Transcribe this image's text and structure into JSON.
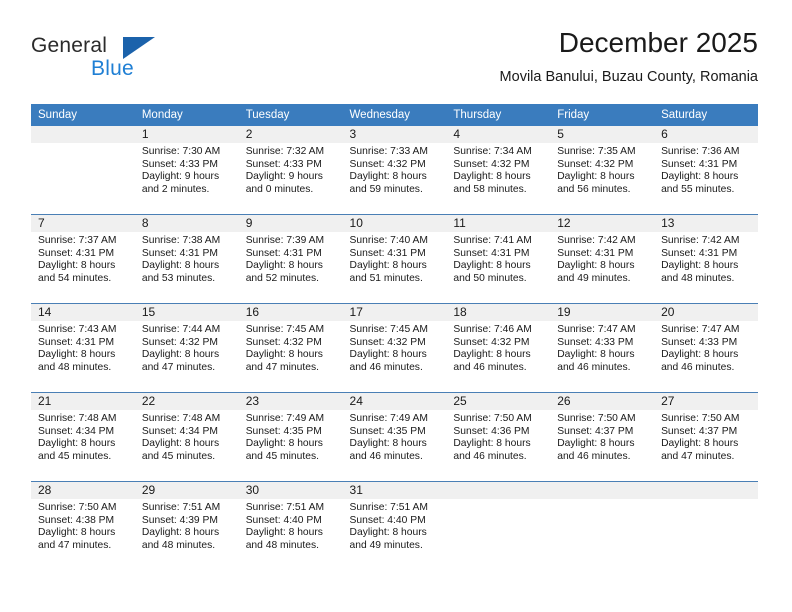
{
  "brand": {
    "name_part1": "General",
    "name_part2": "Blue",
    "triangle_color": "#1b62ab",
    "blue_color": "#1f7fd4"
  },
  "header": {
    "title": "December 2025",
    "subtitle": "Movila Banului, Buzau County, Romania"
  },
  "calendar": {
    "header_bg": "#3a7cbe",
    "daynum_band_bg": "#f0f0f0",
    "weekdays": [
      "Sunday",
      "Monday",
      "Tuesday",
      "Wednesday",
      "Thursday",
      "Friday",
      "Saturday"
    ],
    "weeks": [
      [
        {
          "day": "",
          "lines": []
        },
        {
          "day": "1",
          "lines": [
            "Sunrise: 7:30 AM",
            "Sunset: 4:33 PM",
            "Daylight: 9 hours",
            "and 2 minutes."
          ]
        },
        {
          "day": "2",
          "lines": [
            "Sunrise: 7:32 AM",
            "Sunset: 4:33 PM",
            "Daylight: 9 hours",
            "and 0 minutes."
          ]
        },
        {
          "day": "3",
          "lines": [
            "Sunrise: 7:33 AM",
            "Sunset: 4:32 PM",
            "Daylight: 8 hours",
            "and 59 minutes."
          ]
        },
        {
          "day": "4",
          "lines": [
            "Sunrise: 7:34 AM",
            "Sunset: 4:32 PM",
            "Daylight: 8 hours",
            "and 58 minutes."
          ]
        },
        {
          "day": "5",
          "lines": [
            "Sunrise: 7:35 AM",
            "Sunset: 4:32 PM",
            "Daylight: 8 hours",
            "and 56 minutes."
          ]
        },
        {
          "day": "6",
          "lines": [
            "Sunrise: 7:36 AM",
            "Sunset: 4:31 PM",
            "Daylight: 8 hours",
            "and 55 minutes."
          ]
        }
      ],
      [
        {
          "day": "7",
          "lines": [
            "Sunrise: 7:37 AM",
            "Sunset: 4:31 PM",
            "Daylight: 8 hours",
            "and 54 minutes."
          ]
        },
        {
          "day": "8",
          "lines": [
            "Sunrise: 7:38 AM",
            "Sunset: 4:31 PM",
            "Daylight: 8 hours",
            "and 53 minutes."
          ]
        },
        {
          "day": "9",
          "lines": [
            "Sunrise: 7:39 AM",
            "Sunset: 4:31 PM",
            "Daylight: 8 hours",
            "and 52 minutes."
          ]
        },
        {
          "day": "10",
          "lines": [
            "Sunrise: 7:40 AM",
            "Sunset: 4:31 PM",
            "Daylight: 8 hours",
            "and 51 minutes."
          ]
        },
        {
          "day": "11",
          "lines": [
            "Sunrise: 7:41 AM",
            "Sunset: 4:31 PM",
            "Daylight: 8 hours",
            "and 50 minutes."
          ]
        },
        {
          "day": "12",
          "lines": [
            "Sunrise: 7:42 AM",
            "Sunset: 4:31 PM",
            "Daylight: 8 hours",
            "and 49 minutes."
          ]
        },
        {
          "day": "13",
          "lines": [
            "Sunrise: 7:42 AM",
            "Sunset: 4:31 PM",
            "Daylight: 8 hours",
            "and 48 minutes."
          ]
        }
      ],
      [
        {
          "day": "14",
          "lines": [
            "Sunrise: 7:43 AM",
            "Sunset: 4:31 PM",
            "Daylight: 8 hours",
            "and 48 minutes."
          ]
        },
        {
          "day": "15",
          "lines": [
            "Sunrise: 7:44 AM",
            "Sunset: 4:32 PM",
            "Daylight: 8 hours",
            "and 47 minutes."
          ]
        },
        {
          "day": "16",
          "lines": [
            "Sunrise: 7:45 AM",
            "Sunset: 4:32 PM",
            "Daylight: 8 hours",
            "and 47 minutes."
          ]
        },
        {
          "day": "17",
          "lines": [
            "Sunrise: 7:45 AM",
            "Sunset: 4:32 PM",
            "Daylight: 8 hours",
            "and 46 minutes."
          ]
        },
        {
          "day": "18",
          "lines": [
            "Sunrise: 7:46 AM",
            "Sunset: 4:32 PM",
            "Daylight: 8 hours",
            "and 46 minutes."
          ]
        },
        {
          "day": "19",
          "lines": [
            "Sunrise: 7:47 AM",
            "Sunset: 4:33 PM",
            "Daylight: 8 hours",
            "and 46 minutes."
          ]
        },
        {
          "day": "20",
          "lines": [
            "Sunrise: 7:47 AM",
            "Sunset: 4:33 PM",
            "Daylight: 8 hours",
            "and 46 minutes."
          ]
        }
      ],
      [
        {
          "day": "21",
          "lines": [
            "Sunrise: 7:48 AM",
            "Sunset: 4:34 PM",
            "Daylight: 8 hours",
            "and 45 minutes."
          ]
        },
        {
          "day": "22",
          "lines": [
            "Sunrise: 7:48 AM",
            "Sunset: 4:34 PM",
            "Daylight: 8 hours",
            "and 45 minutes."
          ]
        },
        {
          "day": "23",
          "lines": [
            "Sunrise: 7:49 AM",
            "Sunset: 4:35 PM",
            "Daylight: 8 hours",
            "and 45 minutes."
          ]
        },
        {
          "day": "24",
          "lines": [
            "Sunrise: 7:49 AM",
            "Sunset: 4:35 PM",
            "Daylight: 8 hours",
            "and 46 minutes."
          ]
        },
        {
          "day": "25",
          "lines": [
            "Sunrise: 7:50 AM",
            "Sunset: 4:36 PM",
            "Daylight: 8 hours",
            "and 46 minutes."
          ]
        },
        {
          "day": "26",
          "lines": [
            "Sunrise: 7:50 AM",
            "Sunset: 4:37 PM",
            "Daylight: 8 hours",
            "and 46 minutes."
          ]
        },
        {
          "day": "27",
          "lines": [
            "Sunrise: 7:50 AM",
            "Sunset: 4:37 PM",
            "Daylight: 8 hours",
            "and 47 minutes."
          ]
        }
      ],
      [
        {
          "day": "28",
          "lines": [
            "Sunrise: 7:50 AM",
            "Sunset: 4:38 PM",
            "Daylight: 8 hours",
            "and 47 minutes."
          ]
        },
        {
          "day": "29",
          "lines": [
            "Sunrise: 7:51 AM",
            "Sunset: 4:39 PM",
            "Daylight: 8 hours",
            "and 48 minutes."
          ]
        },
        {
          "day": "30",
          "lines": [
            "Sunrise: 7:51 AM",
            "Sunset: 4:40 PM",
            "Daylight: 8 hours",
            "and 48 minutes."
          ]
        },
        {
          "day": "31",
          "lines": [
            "Sunrise: 7:51 AM",
            "Sunset: 4:40 PM",
            "Daylight: 8 hours",
            "and 49 minutes."
          ]
        },
        {
          "day": "",
          "lines": []
        },
        {
          "day": "",
          "lines": []
        },
        {
          "day": "",
          "lines": []
        }
      ]
    ]
  }
}
